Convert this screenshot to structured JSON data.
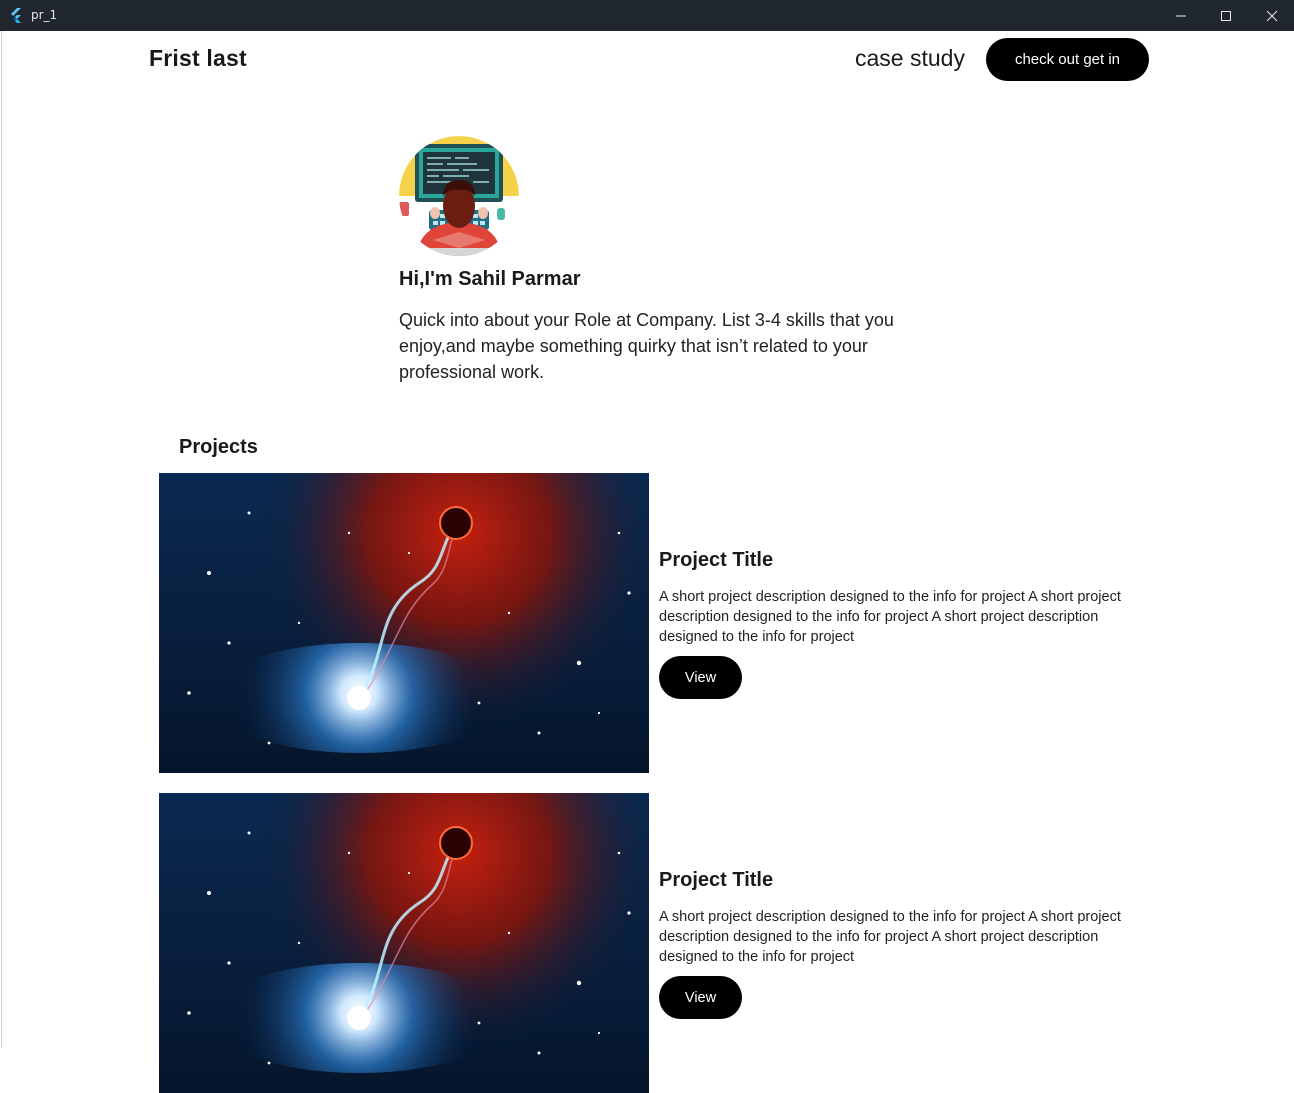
{
  "window": {
    "title": "pr_1"
  },
  "header": {
    "brand": "Frist last",
    "nav_link": "case study",
    "cta_label": "check out get in"
  },
  "hero": {
    "greeting": "Hi,I'm Sahil Parmar",
    "intro": "Quick into about your Role at Company. List 3-4 skills that you enjoy,and maybe something quirky that isn’t related to your professional work."
  },
  "projects": {
    "heading": "Projects",
    "items": [
      {
        "title": "Project Title",
        "description": "A short project description designed to the info for project A short project description designed to the info for project A short project description designed to the info for project",
        "button": "View"
      },
      {
        "title": "Project Title",
        "description": "A short project description designed to the info for project A short project description designed to the info for project A short project description designed to the info for project",
        "button": "View"
      }
    ]
  },
  "colors": {
    "titlebar": "#1f262e",
    "button_bg": "#000000",
    "button_text": "#ffffff",
    "avatar_bg": "#f6d24a"
  },
  "icons": {
    "app": "flutter-icon",
    "minimize": "minimize-icon",
    "maximize": "maximize-icon",
    "close": "close-icon"
  }
}
